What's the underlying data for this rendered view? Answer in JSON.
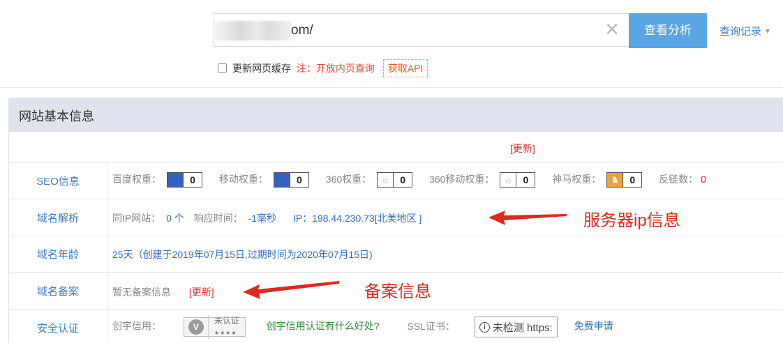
{
  "search": {
    "value": "om/",
    "button_label": "查看分析",
    "history_label": "查询记录"
  },
  "options": {
    "cache_label": "更新网页缓存",
    "note_label": "注：开放内页查询",
    "api_label": "获取API"
  },
  "panel": {
    "title": "网站基本信息",
    "update_link": "[更新]",
    "rows": {
      "seo": {
        "label": "SEO信息",
        "baidu_label": "百度权重：",
        "baidu_value": "0",
        "mobile_label": "移动权重：",
        "mobile_value": "0",
        "r360_label": "360权重：",
        "r360_value": "0",
        "r360m_label": "360移动权重：",
        "r360m_value": "0",
        "shenma_label": "神马权重：",
        "shenma_value": "0",
        "backlinks_label": "反链数：",
        "backlinks_value": "0"
      },
      "dns": {
        "label": "域名解析",
        "same_ip_label": "同IP网站：",
        "same_ip_value": "0 个",
        "response_label": "响应时间：",
        "response_value": "-1毫秒",
        "ip_text": "IP：198.44.230.73[北美地区 ]"
      },
      "age": {
        "label": "域名年龄",
        "text": "25天（创建于2019年07月15日,过期时间为2020年07月15日)"
      },
      "icp": {
        "label": "域名备案",
        "text": "暂无备案信息",
        "update_link": "[更新]"
      },
      "security": {
        "label": "安全认证",
        "chuangyu_label": "创宇信用：",
        "cert_badge": "未认证",
        "cert_stars": "★★★★",
        "benefit_link": "创宇信用认证有什么好处?",
        "ssl_label": "SSL证书：",
        "https_badge": "未检测 https:",
        "apply_link": "免费申请"
      }
    }
  },
  "annotations": {
    "server_ip": "服务器ip信息",
    "icp": "备案信息"
  },
  "colors": {
    "accent": "#5aa5e4",
    "link": "#2f6eb5",
    "annotation": "#e0281e"
  }
}
